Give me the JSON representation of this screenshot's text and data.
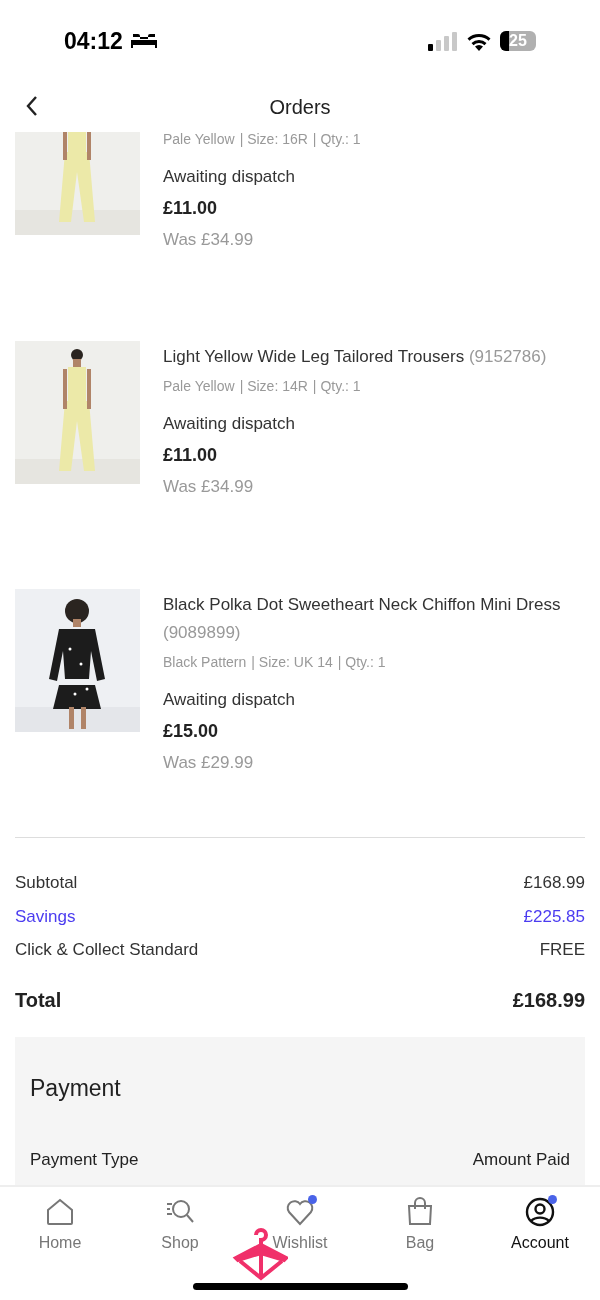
{
  "status_bar": {
    "time": "04:12",
    "battery": "25"
  },
  "header": {
    "title": "Orders"
  },
  "items": [
    {
      "colour": "Pale Yellow",
      "size": "| Size: 16R",
      "qty": "| Qty.: 1",
      "status": "Awaiting dispatch",
      "price": "£11.00",
      "was": "Was £34.99"
    },
    {
      "title": "Light Yellow Wide Leg Tailored Trousers",
      "code": "(9152786)",
      "colour": "Pale Yellow",
      "size": "| Size: 14R",
      "qty": "| Qty.: 1",
      "status": "Awaiting dispatch",
      "price": "£11.00",
      "was": "Was £34.99"
    },
    {
      "title": "Black Polka Dot Sweetheart Neck Chiffon Mini Dress",
      "code": "(9089899)",
      "colour": "Black Pattern",
      "size": "| Size: UK 14",
      "qty": "| Qty.: 1",
      "status": "Awaiting dispatch",
      "price": "£15.00",
      "was": "Was £29.99"
    }
  ],
  "summary": [
    {
      "label": "Subtotal",
      "value": "£168.99",
      "highlight": false
    },
    {
      "label": "Savings",
      "value": "£225.85",
      "highlight": true
    },
    {
      "label": "Click & Collect Standard",
      "value": "FREE",
      "highlight": false
    }
  ],
  "total": {
    "label": "Total",
    "value": "£168.99"
  },
  "payment": {
    "title": "Payment",
    "columns": [
      "Payment Type",
      "Amount Paid"
    ]
  },
  "nav": [
    {
      "kind": "home",
      "label": "Home",
      "dot": false,
      "selected": false
    },
    {
      "kind": "shop",
      "label": "Shop",
      "dot": false,
      "selected": false
    },
    {
      "kind": "wishlist",
      "label": "Wishlist",
      "dot": true,
      "selected": false
    },
    {
      "kind": "bag",
      "label": "Bag",
      "dot": false,
      "selected": false
    },
    {
      "kind": "account",
      "label": "Account",
      "dot": true,
      "selected": true
    }
  ]
}
